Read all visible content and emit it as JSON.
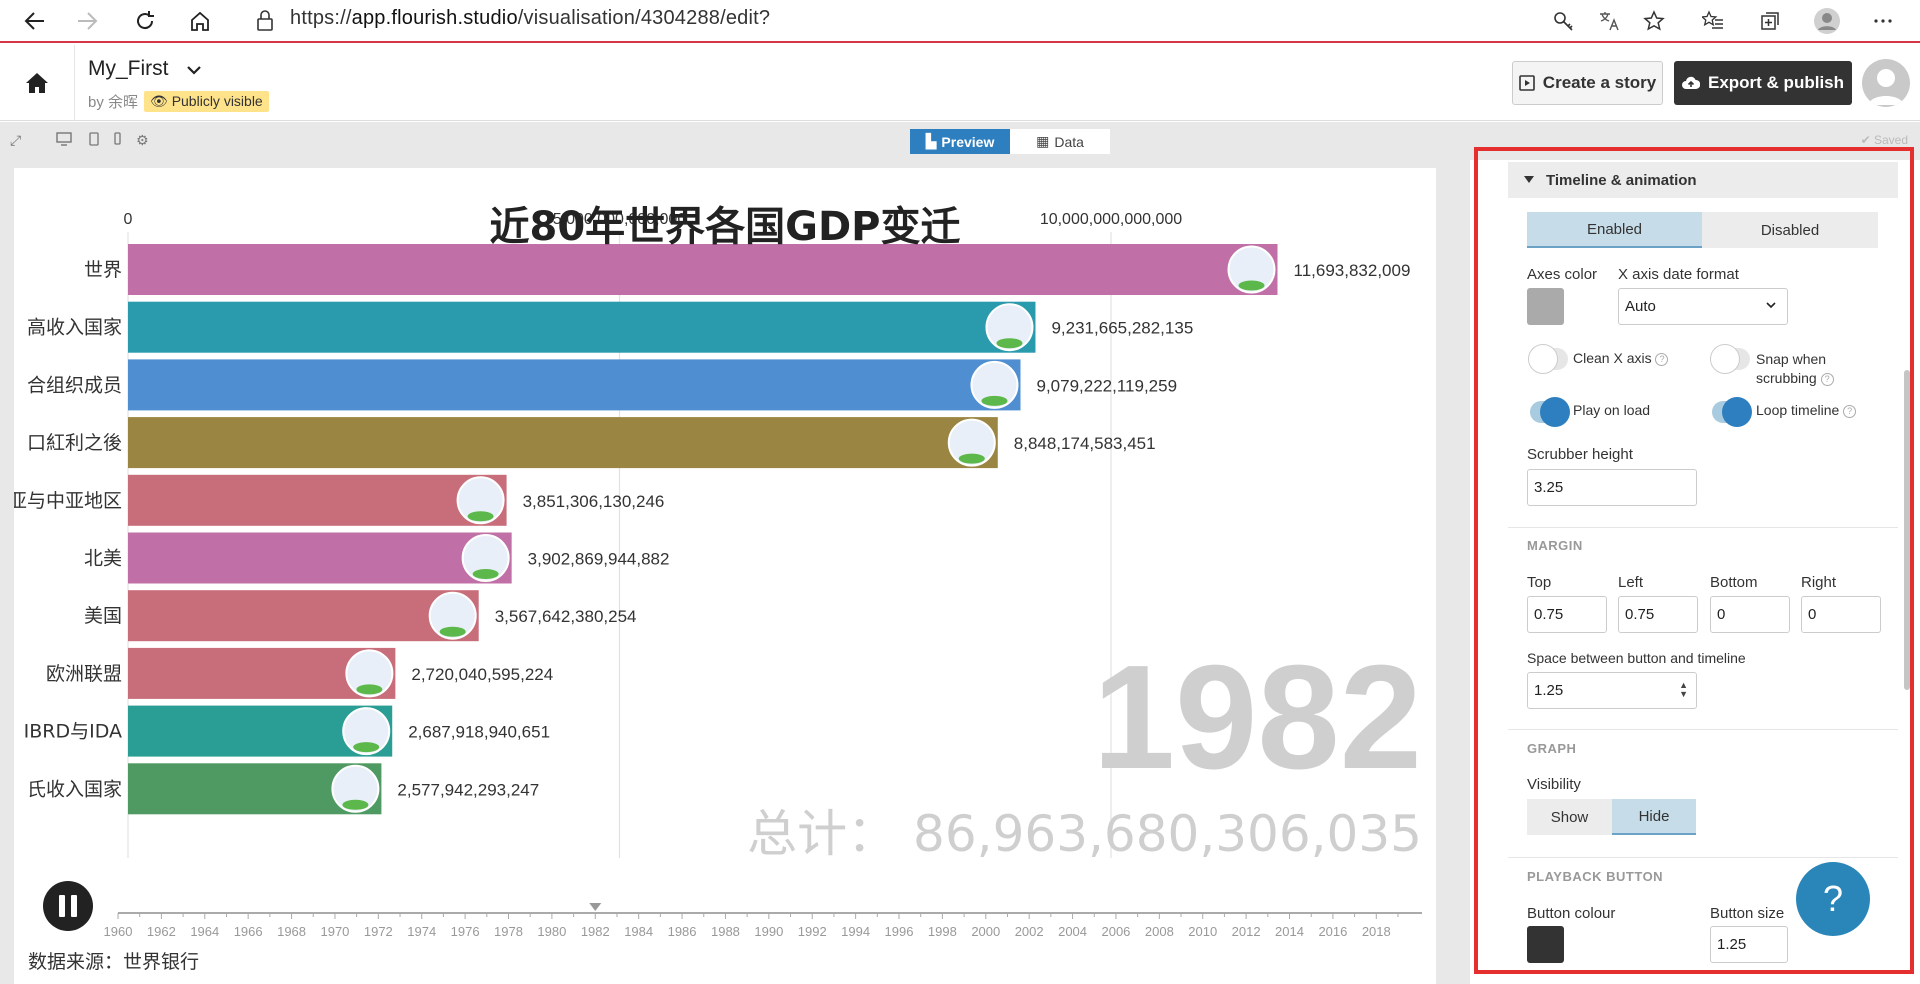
{
  "browser": {
    "url_prefix": "https://",
    "url_host": "app.flourish.studio",
    "url_path": "/visualisation/4304288/edit?"
  },
  "header": {
    "title": "My_First",
    "byline": "by 余晖",
    "badge": "Publicly visible",
    "create_story": "Create a story",
    "export": "Export & publish"
  },
  "toolbar": {
    "preview": "Preview",
    "data": "Data",
    "saved": "✔ Saved"
  },
  "chart_data": {
    "type": "bar",
    "title": "近80年世界各国GDP变迁",
    "axis_ticks": [
      "0",
      "5,000,000,000,000",
      "10,000,000,000,000"
    ],
    "xlim": [
      0,
      11700000000000
    ],
    "categories": [
      "世界",
      "高收入国家",
      "经合组织成员",
      "人口红利之後",
      "东亚与中亚地区",
      "北美",
      "美国",
      "欧洲联盟",
      "IBRD与IDA",
      "中低收入国家"
    ],
    "visible_labels": [
      "世界",
      "高收入国家",
      "合组织成员",
      "口紅利之後",
      "亚与中亚地区",
      "北美",
      "美国",
      "欧洲联盟",
      "IBRD与IDA",
      "氏收入国家"
    ],
    "values": [
      11693832009000,
      9231665282135,
      9079222119259,
      8848174583451,
      3851306130246,
      3902869944882,
      3567642380254,
      2720040595224,
      2687918940651,
      2577942293247
    ],
    "value_labels": [
      "11,693,832,009",
      "9,231,665,282,135",
      "9,079,222,119,259",
      "8,848,174,583,451",
      "3,851,306,130,246",
      "3,902,869,944,882",
      "3,567,642,380,254",
      "2,720,040,595,224",
      "2,687,918,940,651",
      "2,577,942,293,247"
    ],
    "colors": [
      "#c070a6",
      "#2a9aad",
      "#4f8ed0",
      "#9a8542",
      "#c86e7a",
      "#c070a6",
      "#c86e7a",
      "#c86e7a",
      "#2a9e95",
      "#4f9a62"
    ],
    "year": "1982",
    "total_label": "总计：",
    "total_value": "86,963,680,306,035",
    "timeline_years": [
      "1960",
      "1962",
      "1964",
      "1966",
      "1968",
      "1970",
      "1972",
      "1974",
      "1976",
      "1978",
      "1980",
      "1982",
      "1984",
      "1986",
      "1988",
      "1990",
      "1992",
      "1994",
      "1996",
      "1998",
      "2000",
      "2002",
      "2004",
      "2006",
      "2008",
      "2010",
      "2012",
      "2014",
      "2016",
      "2018"
    ],
    "current_year": 1982
  },
  "source": "数据来源：世界银行",
  "panel": {
    "section_title": "Timeline & animation",
    "enabled": "Enabled",
    "disabled": "Disabled",
    "axes_color_label": "Axes color",
    "axes_color": "#aaaaaa",
    "xfmt_label": "X axis date format",
    "xfmt_value": "Auto",
    "clean_x": "Clean X axis",
    "snap_1": "Snap when",
    "snap_2": "scrubbing",
    "play_on_load": "Play on load",
    "loop": "Loop timeline",
    "scrubber_label": "Scrubber height",
    "scrubber_value": "3.25",
    "margin_cap": "MARGIN",
    "m_top": "Top",
    "m_left": "Left",
    "m_bottom": "Bottom",
    "m_right": "Right",
    "m_top_v": "0.75",
    "m_left_v": "0.75",
    "m_bottom_v": "0",
    "m_right_v": "0",
    "space_label": "Space between button and timeline",
    "space_value": "1.25",
    "graph_cap": "GRAPH",
    "visibility": "Visibility",
    "show": "Show",
    "hide": "Hide",
    "playback_cap": "PLAYBACK BUTTON",
    "btn_colour_label": "Button colour",
    "btn_colour": "#333333",
    "btn_size_label": "Button size",
    "btn_size_value": "1.25",
    "help": "?"
  }
}
